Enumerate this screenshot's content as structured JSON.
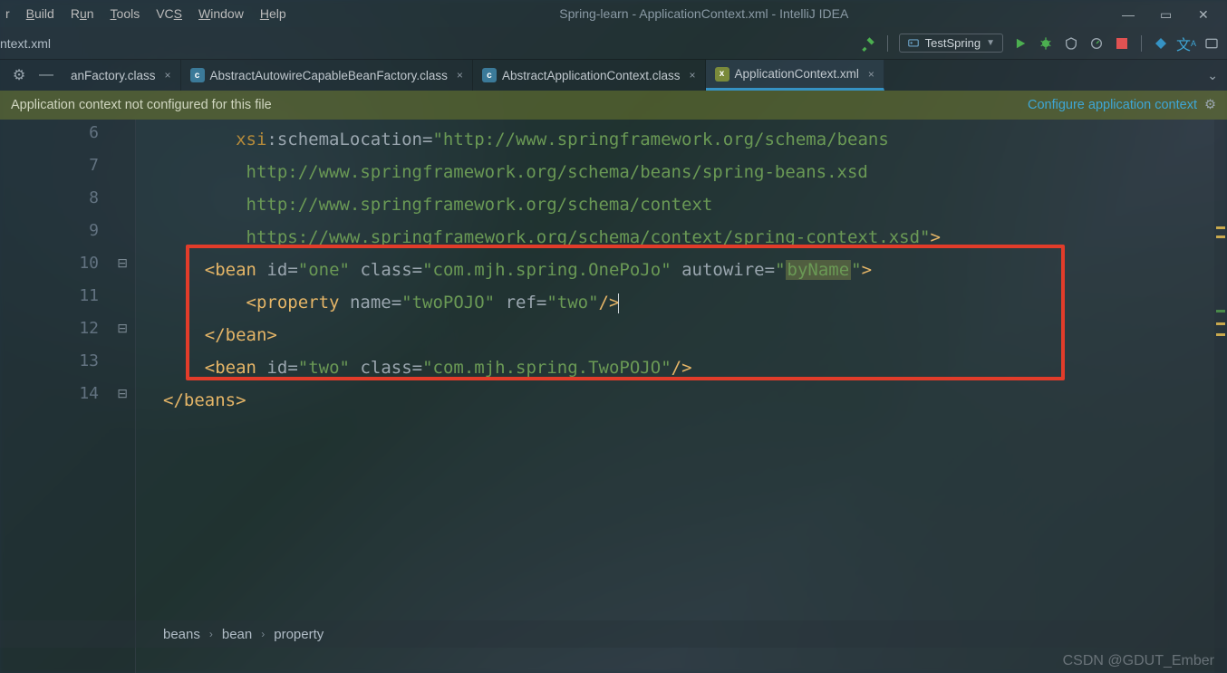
{
  "menu": {
    "items": [
      "Build",
      "Run",
      "Tools",
      "VCS",
      "Window",
      "Help"
    ],
    "first_partial": "r"
  },
  "title": "Spring-learn - ApplicationContext.xml - IntelliJ IDEA",
  "nav_left": "ntext.xml",
  "run_config": {
    "label": "TestSpring"
  },
  "tabrow": {
    "t0": {
      "label": "anFactory.class"
    },
    "t1": {
      "label": "AbstractAutowireCapableBeanFactory.class"
    },
    "t2": {
      "label": "AbstractApplicationContext.class"
    },
    "t3": {
      "label": "ApplicationContext.xml"
    }
  },
  "banner": {
    "msg": "Application context not configured for this file",
    "link": "Configure application context"
  },
  "gutter_lines": [
    "6",
    "7",
    "8",
    "9",
    "10",
    "11",
    "12",
    "13",
    "14"
  ],
  "code": {
    "l6_ns": "xsi",
    "l6_attr": ":schemaLocation",
    "l6_str": "\"http://www.springframework.org/schema/beans",
    "l7": "http://www.springframework.org/schema/beans/spring-beans.xsd",
    "l8": "http://www.springframework.org/schema/context",
    "l9": "https://www.springframework.org/schema/context/spring-context.xsd\"",
    "l10_tag": "bean",
    "l10_a1": "id",
    "l10_v1": "\"one\"",
    "l10_a2": "class",
    "l10_v2": "\"com.mjh.spring.OnePoJo\"",
    "l10_a3": "autowire",
    "l10_v3": "\"byName\"",
    "l11_tag": "property",
    "l11_a1": "name",
    "l11_v1": "\"twoPOJO\"",
    "l11_a2": "ref",
    "l11_v2": "\"two\"",
    "l12_close": "bean",
    "l13_tag": "bean",
    "l13_a1": "id",
    "l13_v1": "\"two\"",
    "l13_a2": "class",
    "l13_v2": "\"com.mjh.spring.TwoPOJO\"",
    "l14_close": "beans"
  },
  "breadcrumb": {
    "a": "beans",
    "b": "bean",
    "c": "property"
  },
  "watermark": "CSDN @GDUT_Ember"
}
